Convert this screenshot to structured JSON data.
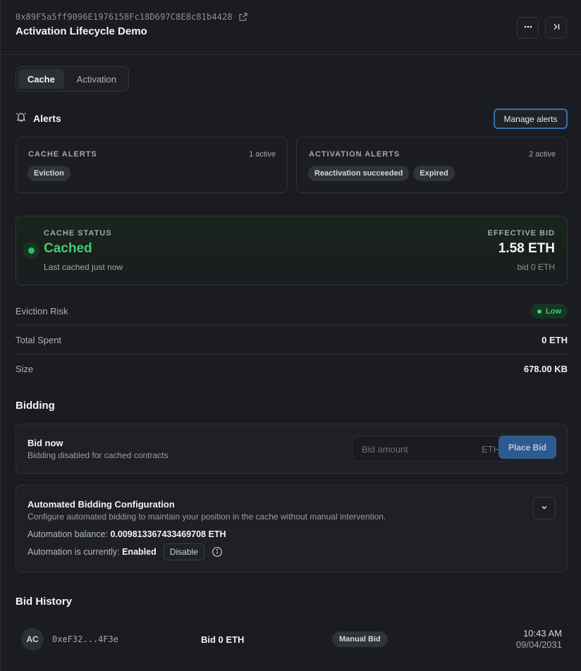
{
  "header": {
    "address": "0x89F5a5ff9096E1976158Fc18D697C8E8c81b4428",
    "title": "Activation Lifecycle Demo",
    "icons": [
      "external-link-icon",
      "more-horizontal-icon",
      "collapse-panel-icon"
    ]
  },
  "tabs": [
    {
      "label": "Cache",
      "active": true
    },
    {
      "label": "Activation",
      "active": false
    }
  ],
  "alerts": {
    "title": "Alerts",
    "manage_label": "Manage alerts",
    "cache": {
      "label": "CACHE ALERTS",
      "count": "1 active",
      "chips": [
        "Eviction"
      ]
    },
    "activation": {
      "label": "ACTIVATION ALERTS",
      "count": "2 active",
      "chips": [
        "Reactivation succeeded",
        "Expired"
      ]
    }
  },
  "cache_status": {
    "label": "CACHE STATUS",
    "value": "Cached",
    "sub": "Last cached just now",
    "effective_bid_label": "EFFECTIVE BID",
    "effective_bid_value": "1.58 ETH",
    "bid_sub": "bid 0 ETH",
    "status_color": "#22c55e"
  },
  "stats": {
    "eviction_risk_label": "Eviction Risk",
    "eviction_risk_value": "Low",
    "total_spent_label": "Total Spent",
    "total_spent_value": "0 ETH",
    "size_label": "Size",
    "size_value": "678.00 KB"
  },
  "bidding": {
    "title": "Bidding",
    "bid_now_title": "Bid now",
    "bid_now_sub": "Bidding disabled for cached contracts",
    "input_placeholder": "Bid amount",
    "input_unit": "ETH",
    "place_label": "Place Bid"
  },
  "automation": {
    "title": "Automated Bidding Configuration",
    "sub": "Configure automated bidding to maintain your position in the cache without manual intervention.",
    "balance_label": "Automation balance:",
    "balance_value": "0.009813367433469708 ETH",
    "state_label": "Automation is currently:",
    "state_value": "Enabled",
    "disable_label": "Disable"
  },
  "history": {
    "title": "Bid History",
    "rows": [
      {
        "avatar": "AC",
        "address": "0xeF32...4F3e",
        "amount": "Bid 0 ETH",
        "type": "Manual Bid",
        "time": "10:43 AM",
        "date": "09/04/2031"
      }
    ]
  },
  "colors": {
    "background": "#1a1c21",
    "accent_blue": "#3c6ea8",
    "success_green": "#3ecf6b"
  }
}
